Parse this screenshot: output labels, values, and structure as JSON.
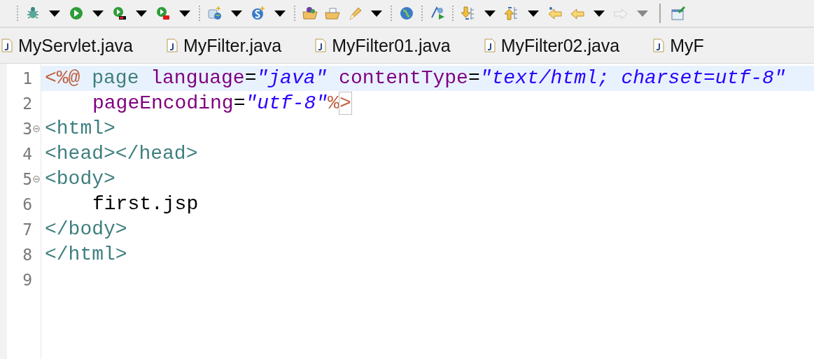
{
  "toolbar": {
    "items": [
      {
        "kind": "separator"
      },
      {
        "kind": "button",
        "dropdown": true,
        "disabled": false
      },
      {
        "kind": "button",
        "dropdown": true,
        "disabled": false
      },
      {
        "kind": "button",
        "dropdown": true,
        "disabled": false
      },
      {
        "kind": "button",
        "dropdown": true,
        "disabled": false
      },
      {
        "kind": "separator"
      },
      {
        "kind": "button",
        "dropdown": true,
        "disabled": false
      },
      {
        "kind": "button",
        "dropdown": true,
        "disabled": false
      },
      {
        "kind": "separator"
      },
      {
        "kind": "button",
        "dropdown": false,
        "disabled": false
      },
      {
        "kind": "button",
        "dropdown": false,
        "disabled": false
      },
      {
        "kind": "button",
        "dropdown": true,
        "disabled": false
      },
      {
        "kind": "separator"
      },
      {
        "kind": "button",
        "dropdown": false,
        "disabled": false
      },
      {
        "kind": "separator"
      },
      {
        "kind": "button",
        "dropdown": false,
        "disabled": false
      },
      {
        "kind": "separator"
      },
      {
        "kind": "button",
        "dropdown": true,
        "disabled": false
      },
      {
        "kind": "button",
        "dropdown": true,
        "disabled": false
      },
      {
        "kind": "button",
        "dropdown": false,
        "disabled": false
      },
      {
        "kind": "button",
        "dropdown": true,
        "disabled": false
      },
      {
        "kind": "button",
        "dropdown": true,
        "disabled": true
      },
      {
        "kind": "rule"
      },
      {
        "kind": "button",
        "dropdown": false,
        "disabled": false
      }
    ]
  },
  "tabs": [
    {
      "label": "MyServlet.java"
    },
    {
      "label": "MyFilter.java"
    },
    {
      "label": "MyFilter01.java"
    },
    {
      "label": "MyFilter02.java"
    },
    {
      "label": "MyF"
    }
  ],
  "editor": {
    "lines": [
      {
        "number": "1",
        "current": true,
        "foldable": false,
        "indent": false,
        "tokens": [
          {
            "kind": "directive",
            "text": "<%@"
          },
          {
            "kind": "tag",
            "text": "page"
          },
          {
            "kind": "attr",
            "text": "language"
          },
          {
            "kind": "eq",
            "text": "="
          },
          {
            "kind": "value",
            "text": "\"java\""
          },
          {
            "kind": "attr",
            "text": "contentType"
          },
          {
            "kind": "eq",
            "text": "="
          },
          {
            "kind": "value",
            "text": "\"text/html; charset=utf-8\""
          }
        ]
      },
      {
        "number": "2",
        "current": false,
        "foldable": false,
        "indent": true,
        "tokens": [
          {
            "kind": "attr",
            "text": "pageEncoding"
          },
          {
            "kind": "eq",
            "text": "="
          },
          {
            "kind": "value",
            "text": "\"utf-8\""
          },
          {
            "kind": "directive",
            "text": "%"
          },
          {
            "kind": "directive",
            "text": ">",
            "matched": true
          }
        ]
      },
      {
        "number": "3",
        "current": false,
        "foldable": true,
        "indent": false,
        "tokens": [
          {
            "kind": "tag",
            "text": "<html>"
          }
        ]
      },
      {
        "number": "4",
        "current": false,
        "foldable": false,
        "indent": false,
        "tokens": [
          {
            "kind": "tag",
            "text": "<head></head>"
          }
        ]
      },
      {
        "number": "5",
        "current": false,
        "foldable": true,
        "indent": false,
        "tokens": [
          {
            "kind": "tag",
            "text": "<body>"
          }
        ]
      },
      {
        "number": "6",
        "current": false,
        "foldable": false,
        "indent": true,
        "tokens": [
          {
            "kind": "text",
            "text": "first.jsp"
          }
        ]
      },
      {
        "number": "7",
        "current": false,
        "foldable": false,
        "indent": false,
        "tokens": [
          {
            "kind": "tag",
            "text": "</body>"
          }
        ]
      },
      {
        "number": "8",
        "current": false,
        "foldable": false,
        "indent": false,
        "tokens": [
          {
            "kind": "tag",
            "text": "</html>"
          }
        ]
      },
      {
        "number": "9",
        "current": false,
        "foldable": false
      }
    ]
  }
}
